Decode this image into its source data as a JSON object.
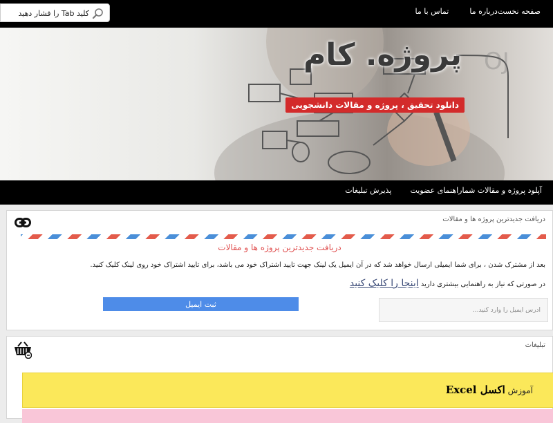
{
  "search": {
    "placeholder": "کلید Tab را فشار دهید"
  },
  "top_nav": {
    "items": [
      {
        "label": "صفحه نخست"
      },
      {
        "label": "درباره ما"
      },
      {
        "label": "تماس با ما"
      }
    ]
  },
  "banner": {
    "title": "پروژه. کام",
    "tagline": "دانلود تحقیق ، پروژه و مقالات دانشجویی"
  },
  "main_nav": {
    "items": [
      {
        "label": "آپلود پروژه و مقالات شما"
      },
      {
        "label": "راهنمای عضویت"
      },
      {
        "label": "پذیرش تبلیغات"
      }
    ]
  },
  "newsletter": {
    "panel_title": "دریافت جدیدترین پروژه ها و مقالات",
    "heading": "دریافت جدیدترین پروژه ها و مقالات",
    "description": "بعد از مشترک شدن ، برای شما ایمیلی ارسال خواهد شد که در آن ایمیل یک لینک جهت تایید اشتراک خود می باشد، برای تایید اشتراک خود روی لینک کلیک کنید.",
    "help_prefix": "در صورتی که نیاز به راهنمایی بیشتری دارید",
    "help_link": "اینجا را کلیک کنید",
    "submit_label": "ثبت ایمیل",
    "email_placeholder": "آدرس ایمیل را وارد کنید..."
  },
  "ads": {
    "panel_title": "تبلیغات",
    "ad1_text": "آموزش",
    "ad1_bold": "اکسل Excel"
  },
  "colors": {
    "bar_bg": "#000000",
    "tagline_bg": "#d32b2b",
    "button_bg": "#4e8ce8",
    "ad_yellow": "#fbe85a",
    "ad_pink": "#f9c6d8"
  },
  "icons": {
    "search": "search-icon",
    "newsletter": "link-icon",
    "ads": "shopping-basket-icon"
  }
}
